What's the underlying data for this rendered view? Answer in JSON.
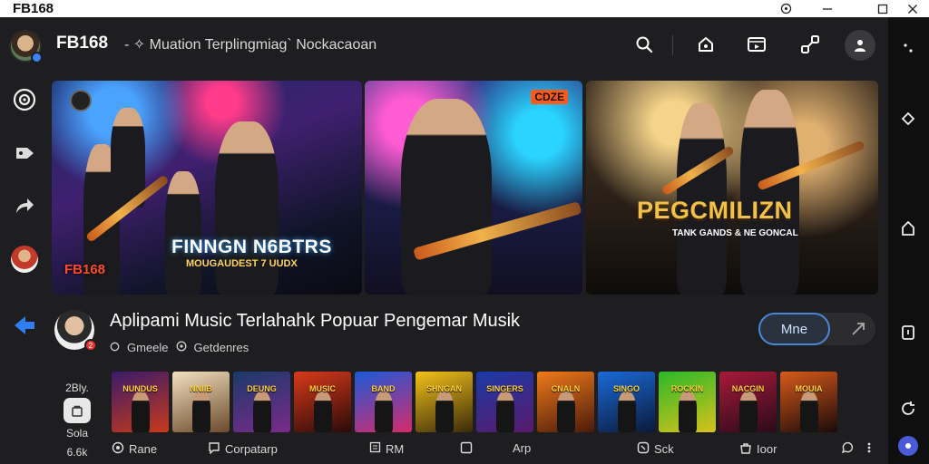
{
  "window": {
    "title": "FB168",
    "controls": [
      "menu-icon",
      "minimize-icon",
      "maximize-icon",
      "close-icon"
    ]
  },
  "header": {
    "app_name": "FB168",
    "subtitle": "- ✧ Muation Terplingmiag` Nockacaoan",
    "icons": [
      "search-icon",
      "home-icon",
      "video-icon",
      "link-icon",
      "profile-icon"
    ]
  },
  "sidebar": {
    "icons": [
      "disc-icon",
      "tag-icon",
      "share-icon",
      "user-avatar",
      "back-arrow-icon"
    ]
  },
  "banners": [
    {
      "title": "FINNGN N6BTRS",
      "subtitle": "MOUGAUDEST 7 UUDX",
      "brand": "FB168"
    },
    {
      "badge": "CDZE"
    },
    {
      "title": "PEGCMILIZN",
      "subtitle": "TANK GANDS & NE GONCAL"
    }
  ],
  "featured": {
    "title": "Aplipami Music Terlahahk Popuar Pengemar Musik",
    "meta_1": "Gmeele",
    "meta_2": "Getdenres",
    "follow_label": "Mne",
    "badge": "2"
  },
  "stats": {
    "top": "2Bly.",
    "label": "Sola",
    "count": "6.6k"
  },
  "thumbnails": [
    {
      "title": "NUNDUS",
      "colors": [
        "#3a1a6a",
        "#c83a1a"
      ]
    },
    {
      "title": "NNIIB",
      "colors": [
        "#f3e0c0",
        "#6a4a2a"
      ]
    },
    {
      "title": "DEUNG",
      "colors": [
        "#1a3a6a",
        "#7a2a8a"
      ]
    },
    {
      "title": "MUSIC",
      "colors": [
        "#d83a1a",
        "#2a0a0a"
      ]
    },
    {
      "title": "BAND",
      "colors": [
        "#1a5ad8",
        "#d82a6a"
      ]
    },
    {
      "title": "SHNGAN",
      "colors": [
        "#f3c21a",
        "#3a2a0a"
      ]
    },
    {
      "title": "SINGERS",
      "colors": [
        "#1a3aa8",
        "#5a1a6a"
      ]
    },
    {
      "title": "CNALN",
      "colors": [
        "#f07a1a",
        "#4a1a0a"
      ]
    },
    {
      "title": "SINGO",
      "colors": [
        "#1a6ad8",
        "#0a1a3a"
      ]
    },
    {
      "title": "ROCKIN",
      "colors": [
        "#2ab82a",
        "#d8c21a"
      ]
    },
    {
      "title": "NACGIN",
      "colors": [
        "#a81a3a",
        "#2a0a1a"
      ]
    },
    {
      "title": "MOUIA",
      "colors": [
        "#d85a1a",
        "#1a0a0a"
      ]
    }
  ],
  "bottom_nav": [
    {
      "icon": "radio-icon",
      "label": "Rane"
    },
    {
      "icon": "chat-icon",
      "label": "Corpatarp"
    },
    {
      "icon": "playlist-icon",
      "label": "RM"
    },
    {
      "icon": "square-icon",
      "label": ""
    },
    {
      "icon": "",
      "label": "Arp"
    },
    {
      "icon": "settings-icon",
      "label": "Sck"
    },
    {
      "icon": "bag-icon",
      "label": "Ioor"
    },
    {
      "icon": "help-icon",
      "label": ""
    },
    {
      "icon": "more-icon",
      "label": ""
    }
  ],
  "right_bar": {
    "icons": [
      "dots-icon",
      "link-icon",
      "home-icon",
      "phone-icon",
      "refresh-icon",
      "assistant-icon"
    ]
  }
}
